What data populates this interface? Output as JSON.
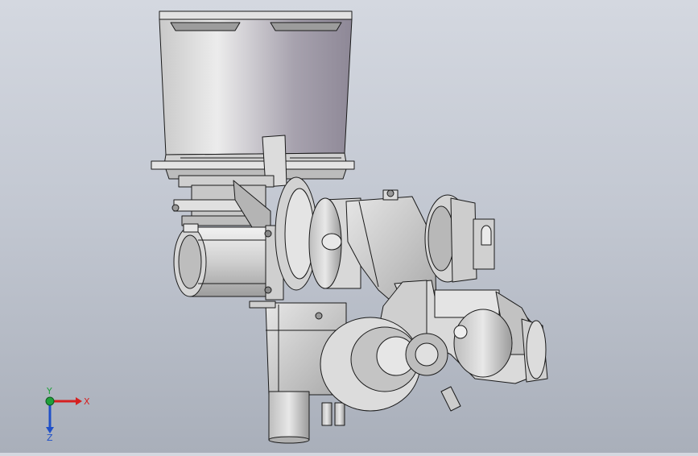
{
  "viewport": {
    "background_top": "#d4d8e0",
    "background_bottom": "#a9afba",
    "model_fill": "#d8d8d8",
    "model_shadow": "#9a9a9a",
    "edge_color": "#1a1a1a"
  },
  "triad": {
    "x_label": "X",
    "y_label": "Y",
    "z_label": "Z",
    "x_color": "#d62020",
    "y_color": "#1fa03a",
    "z_color": "#2050c8"
  }
}
